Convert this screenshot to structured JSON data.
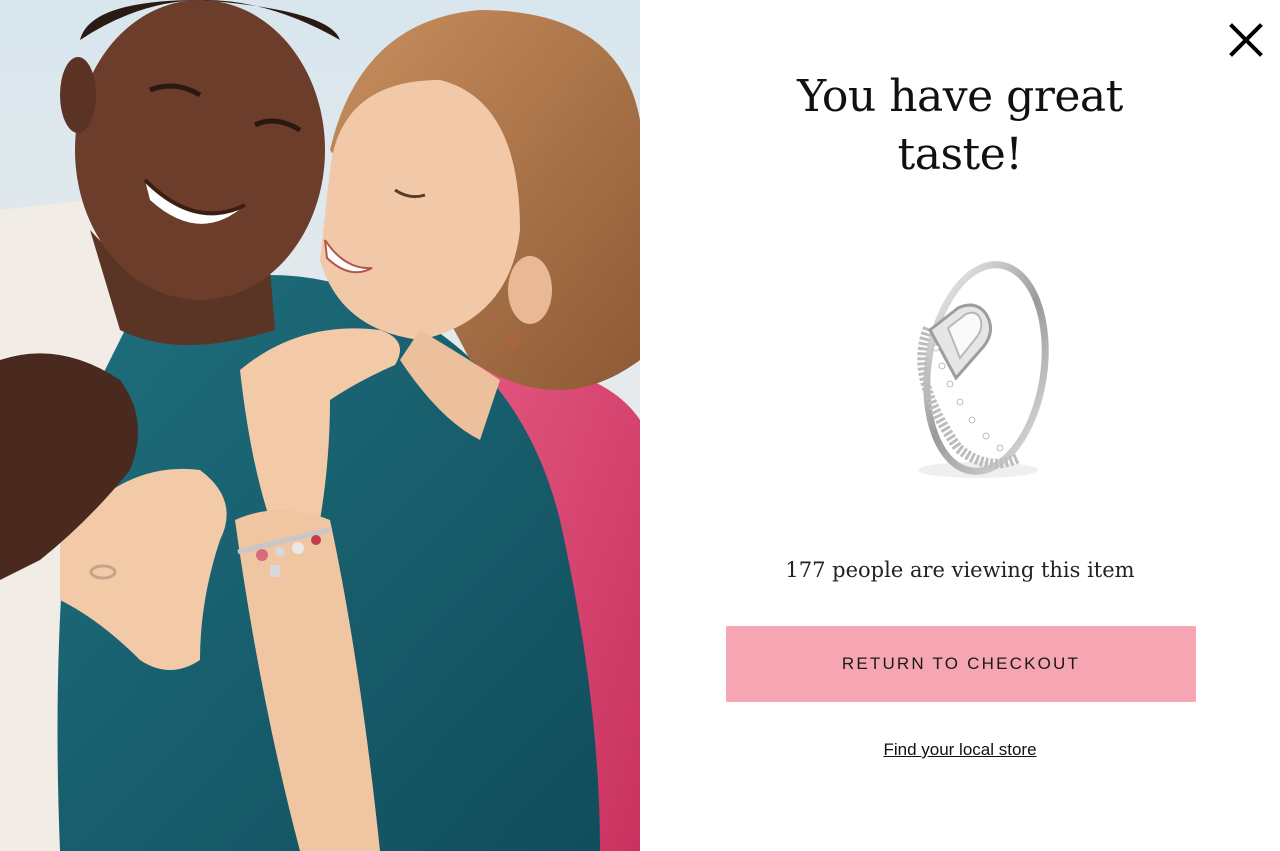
{
  "modal": {
    "close_icon": "close-icon",
    "headline": "You have great taste!",
    "product_image_icon": "ring-icon",
    "viewer_count": 177,
    "viewers_text": "177 people are viewing this item",
    "cta_label": "RETURN TO CHECKOUT",
    "store_link_label": "Find your local store"
  },
  "colors": {
    "cta_background": "#f6a6b2",
    "text": "#111111",
    "background": "#ffffff"
  }
}
